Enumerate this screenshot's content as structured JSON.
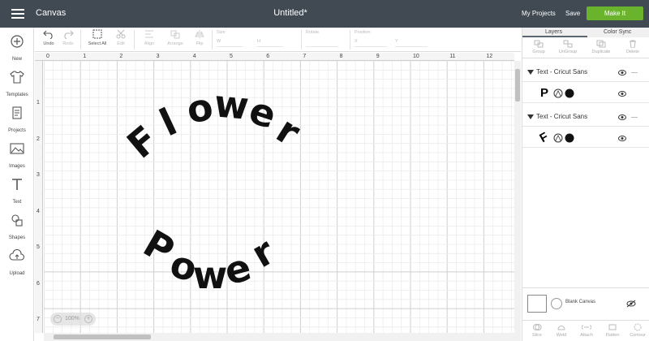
{
  "topbar": {
    "app_title": "Canvas",
    "doc_title": "Untitled*",
    "my_projects": "My Projects",
    "save": "Save",
    "make_it": "Make It"
  },
  "sidebar": {
    "items": [
      {
        "label": "New",
        "icon": "plus-circle-icon"
      },
      {
        "label": "Templates",
        "icon": "shirt-icon"
      },
      {
        "label": "Projects",
        "icon": "projects-icon"
      },
      {
        "label": "Images",
        "icon": "image-icon"
      },
      {
        "label": "Text",
        "icon": "text-icon"
      },
      {
        "label": "Shapes",
        "icon": "shapes-icon"
      },
      {
        "label": "Upload",
        "icon": "upload-cloud-icon"
      }
    ]
  },
  "toolbar": {
    "undo": "Undo",
    "redo": "Redo",
    "select_all": "Select All",
    "edit": "Edit",
    "align": "Align",
    "arrange": "Arrange",
    "flip": "Flip",
    "size": "Size",
    "w": "W",
    "h": "H",
    "rotate": "Rotate",
    "position": "Position",
    "x": "X",
    "y": "Y"
  },
  "rulers": {
    "top": [
      "0",
      "1",
      "2",
      "3",
      "4",
      "5",
      "6",
      "7",
      "8",
      "9",
      "10",
      "11",
      "12"
    ],
    "left": [
      "1",
      "2",
      "3",
      "4",
      "5",
      "6",
      "7"
    ]
  },
  "canvas": {
    "arc_top": [
      "F",
      "l",
      "o",
      "w",
      "e",
      "r"
    ],
    "arc_bottom": [
      "P",
      "o",
      "w",
      "e",
      "r"
    ],
    "zoom": "100%",
    "zoom_minus": "−",
    "zoom_plus": "+"
  },
  "rpanel": {
    "tabs": [
      "Layers",
      "Color Sync"
    ],
    "tools": [
      "Group",
      "UnGroup",
      "Duplicate",
      "Delete"
    ],
    "layers": [
      {
        "name": "Text - Cricut Sans",
        "thumb": "P"
      },
      {
        "name": "Text - Cricut Sans",
        "thumb": "F"
      }
    ],
    "blank_canvas": "Blank Canvas",
    "bottom_tools": [
      "Slice",
      "Weld",
      "Attach",
      "Flatten",
      "Contour"
    ]
  }
}
